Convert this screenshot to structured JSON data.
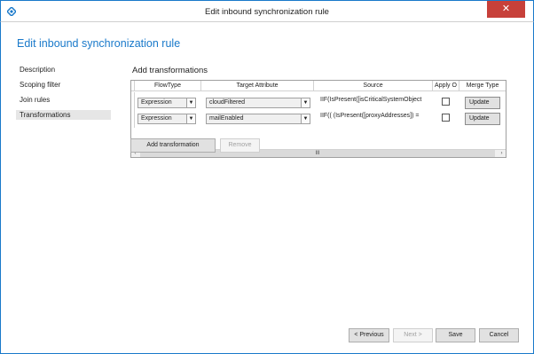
{
  "window": {
    "title": "Edit inbound synchronization rule",
    "close_glyph": "✕",
    "app_icon": "diamond-app-icon"
  },
  "page": {
    "heading": "Edit inbound synchronization rule"
  },
  "sidebar": {
    "items": [
      {
        "label": "Description",
        "selected": false
      },
      {
        "label": "Scoping filter",
        "selected": false
      },
      {
        "label": "Join rules",
        "selected": false
      },
      {
        "label": "Transformations",
        "selected": true
      }
    ]
  },
  "transformations": {
    "title": "Add transformations",
    "columns": [
      "FlowType",
      "Target Attribute",
      "Source",
      "Apply O",
      "Merge Type"
    ],
    "rows": [
      {
        "flow_type": "Expression",
        "target": "cloudFiltered",
        "source": "IIF(IsPresent([isCriticalSystemObject",
        "apply_once": false,
        "merge_type": "Update"
      },
      {
        "flow_type": "Expression",
        "target": "mailEnabled",
        "source": "IIF(( (IsPresent([proxyAddresses]) = ",
        "apply_once": false,
        "merge_type": "Update"
      }
    ],
    "scroll_left": "‹",
    "scroll_right": "›",
    "scroll_thumb": "III",
    "dropdown_glyph": "▼",
    "add_label": "Add transformation",
    "remove_label": "Remove"
  },
  "footer": {
    "previous_label": "< Previous",
    "next_label": "Next >",
    "save_label": "Save",
    "cancel_label": "Cancel"
  },
  "colors": {
    "accent": "#1979ca",
    "close": "#c7403a",
    "selected_nav": "#e6e6e6"
  }
}
